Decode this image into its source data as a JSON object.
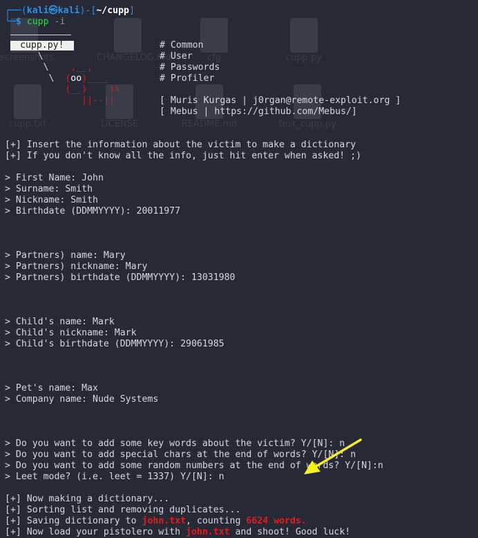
{
  "prompt": {
    "user": "kali",
    "host": "kali",
    "path": "~/cupp",
    "command": "cupp",
    "args": "-i"
  },
  "banner": {
    "label": "cupp.py!",
    "info": [
      "# Common",
      "# User",
      "# Passwords",
      "# Profiler"
    ],
    "credits": [
      "[ Muris Kurgas | j0rgan@remote-exploit.org ]",
      "[ Mebus | https://github.com/Mebus/]"
    ]
  },
  "intro": [
    "[+] Insert the information about the victim to make a dictionary",
    "[+] If you don't know all the info, just hit enter when asked! ;)"
  ],
  "victim": [
    "> First Name: John",
    "> Surname: Smith",
    "> Nickname: Smith",
    "> Birthdate (DDMMYYYY): 20011977"
  ],
  "partner": [
    "> Partners) name: Mary",
    "> Partners) nickname: Mary",
    "> Partners) birthdate (DDMMYYYY): 13031980"
  ],
  "child": [
    "> Child's name: Mark",
    "> Child's nickname: Mark",
    "> Child's birthdate (DDMMYYYY): 29061985"
  ],
  "other": [
    "> Pet's name: Max",
    "> Company name: Nude Systems"
  ],
  "options": [
    "> Do you want to add some key words about the victim? Y/[N]: n",
    "> Do you want to add special chars at the end of words? Y/[N]: n",
    "> Do you want to add some random numbers at the end of words? Y/[N]:n",
    "> Leet mode? (i.e. leet = 1337) Y/[N]: n"
  ],
  "progress": [
    "[+] Now making a dictionary...",
    "[+] Sorting list and removing duplicates..."
  ],
  "saving": {
    "prefix": "[+] Saving dictionary to ",
    "file": "john.txt",
    "middle": ", counting ",
    "count": "6624 words."
  },
  "final": {
    "prefix": "[+] Now load your pistolero with ",
    "file": "john.txt",
    "suffix": " and shoot! Good luck!"
  },
  "desktop_icons": [
    "screenshots",
    "CHANGELOG.md",
    "cfg",
    "cupp.py",
    "cupp.txt",
    "LICENSE",
    "README.md",
    "test_cupp.py"
  ],
  "colors": {
    "background": "#272a36",
    "prompt_blue": "#2f8fe0",
    "command_green": "#3fd15d",
    "highlight_red": "#e21c1c",
    "arrow_yellow": "#f6f21a"
  }
}
